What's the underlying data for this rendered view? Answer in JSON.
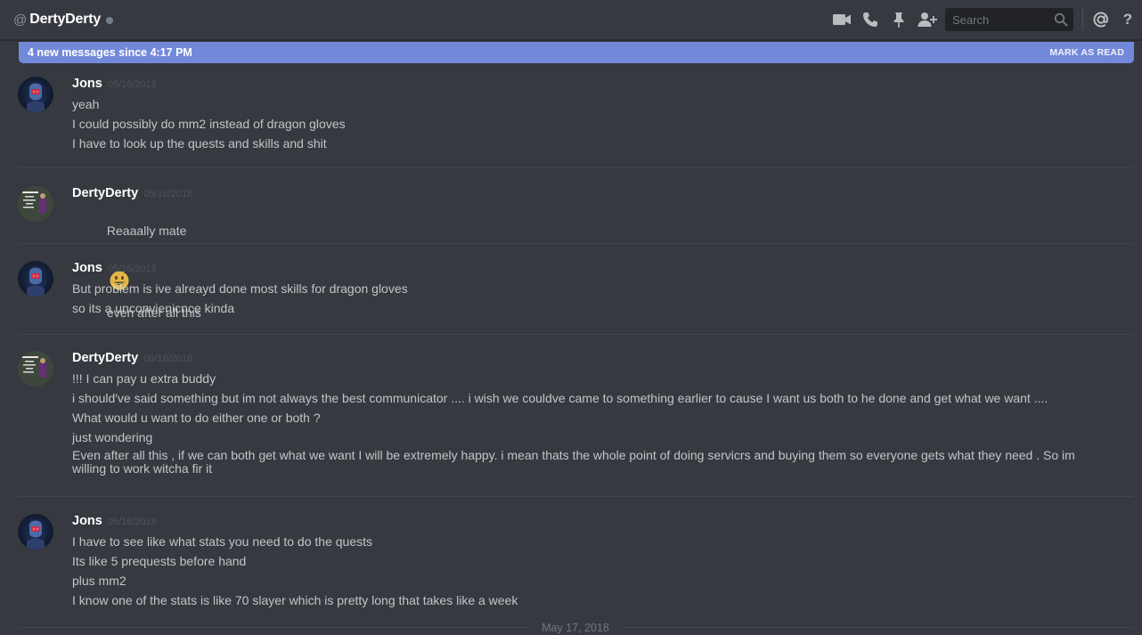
{
  "header": {
    "at_symbol": "@",
    "username": "DertyDerty",
    "status_color": "#747f8d",
    "icons": [
      "video-call-icon",
      "voice-call-icon",
      "pin-icon",
      "add-friend-icon",
      "mention-icon",
      "help-icon"
    ],
    "search_placeholder": "Search",
    "help_label": "?"
  },
  "new_messages_bar": {
    "text": "4 new messages since 4:17 PM",
    "mark_read_label": "MARK AS READ",
    "color": "#7289da"
  },
  "messages": [
    {
      "author": "Jons",
      "timestamp": "05/16/2018",
      "avatar": "avatar-jons",
      "lines": [
        "yeah",
        "I could possibly do mm2 instead of dragon gloves",
        "I have to look up the quests and skills and shit"
      ]
    },
    {
      "author": "DertyDerty",
      "timestamp": "05/16/2018",
      "avatar": "avatar-derty",
      "lines": [
        {
          "before": "Reaaally mate",
          "emoji": "smiley-emoji",
          "after": "even after all this"
        }
      ]
    },
    {
      "author": "Jons",
      "timestamp": "05/16/2018",
      "avatar": "avatar-jons",
      "lines": [
        "But problem is ive alreayd done most skills for dragon gloves",
        "so its a unconvienicnce kinda"
      ]
    },
    {
      "author": "DertyDerty",
      "timestamp": "05/16/2018",
      "avatar": "avatar-derty",
      "lines": [
        "!!! I can pay u extra buddy",
        "i should've said something but im not always the best communicator .... i wish we couldve came to something earlier to cause I want us both to he done and get what we want ....",
        "What would u want to do either one or both ?",
        "just wondering",
        "Even after all this , if we can both get what we want I will be extremely happy. i mean thats the whole point of doing servicrs and buying them so everyone gets what they need . So im\nwilling to work witcha fir it"
      ]
    },
    {
      "author": "Jons",
      "timestamp": "05/16/2018",
      "avatar": "avatar-jons",
      "lines": [
        "I have to see like what stats you need to do the quests",
        "Its like 5 prequests before hand",
        "plus mm2",
        "I know one of the stats is like 70 slayer which is pretty long that takes like a week"
      ]
    }
  ],
  "date_separator": "May 17, 2018"
}
